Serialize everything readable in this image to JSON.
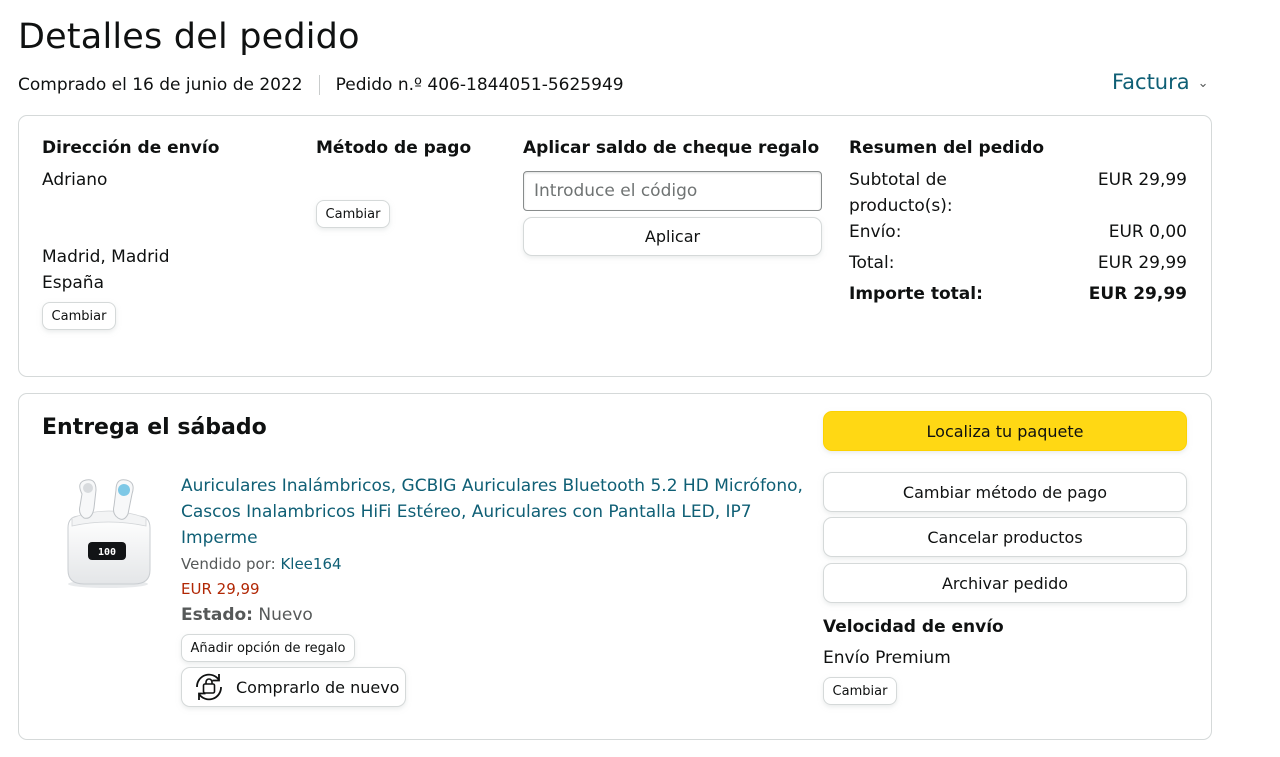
{
  "page": {
    "title": "Detalles del pedido",
    "purchased": "Comprado el 16 de junio de 2022",
    "order_number": "Pedido n.º 406-1844051-5625949",
    "invoice_label": "Factura"
  },
  "shipping_address": {
    "heading": "Dirección de envío",
    "name": "Adriano",
    "city": "Madrid, Madrid",
    "country": "España",
    "change_label": "Cambiar"
  },
  "payment_method": {
    "heading": "Método de pago",
    "change_label": "Cambiar"
  },
  "gift_card": {
    "heading": "Aplicar saldo de cheque regalo",
    "placeholder": "Introduce el código",
    "apply_label": "Aplicar"
  },
  "summary": {
    "heading": "Resumen del pedido",
    "subtotal_label_1": "Subtotal de",
    "subtotal_label_2": "producto(s):",
    "subtotal_value": "EUR 29,99",
    "shipping_label": "Envío:",
    "shipping_value": "EUR 0,00",
    "total_label": "Total:",
    "total_value": "EUR 29,99",
    "grand_total_label": "Importe total:",
    "grand_total_value": "EUR 29,99"
  },
  "delivery": {
    "heading": "Entrega el sábado",
    "product": {
      "title_line1": "Auriculares Inalámbricos, GCBIG Auriculares Bluetooth 5.2 HD Micrófono,",
      "title_line2": "Cascos Inalambricos HiFi Estéreo, Auriculares con Pantalla LED, IP7",
      "title_line3": "Imperme",
      "sold_by_label": "Vendido por:",
      "seller": "Klee164",
      "price": "EUR 29,99",
      "condition_label": "Estado:",
      "condition_value": "Nuevo",
      "display_digits": "100",
      "gift_option_label": "Añadir opción de regalo",
      "buy_again_label": "Comprarlo de nuevo"
    },
    "actions": {
      "track": "Localiza tu paquete",
      "change_payment": "Cambiar método de pago",
      "cancel": "Cancelar productos",
      "archive": "Archivar pedido"
    },
    "speed": {
      "heading": "Velocidad de envío",
      "value": "Envío Premium",
      "change_label": "Cambiar"
    }
  },
  "colors": {
    "link": "#0f5f75",
    "price": "#b12704",
    "primary_button": "#ffd814",
    "border": "#d5d9d9"
  }
}
